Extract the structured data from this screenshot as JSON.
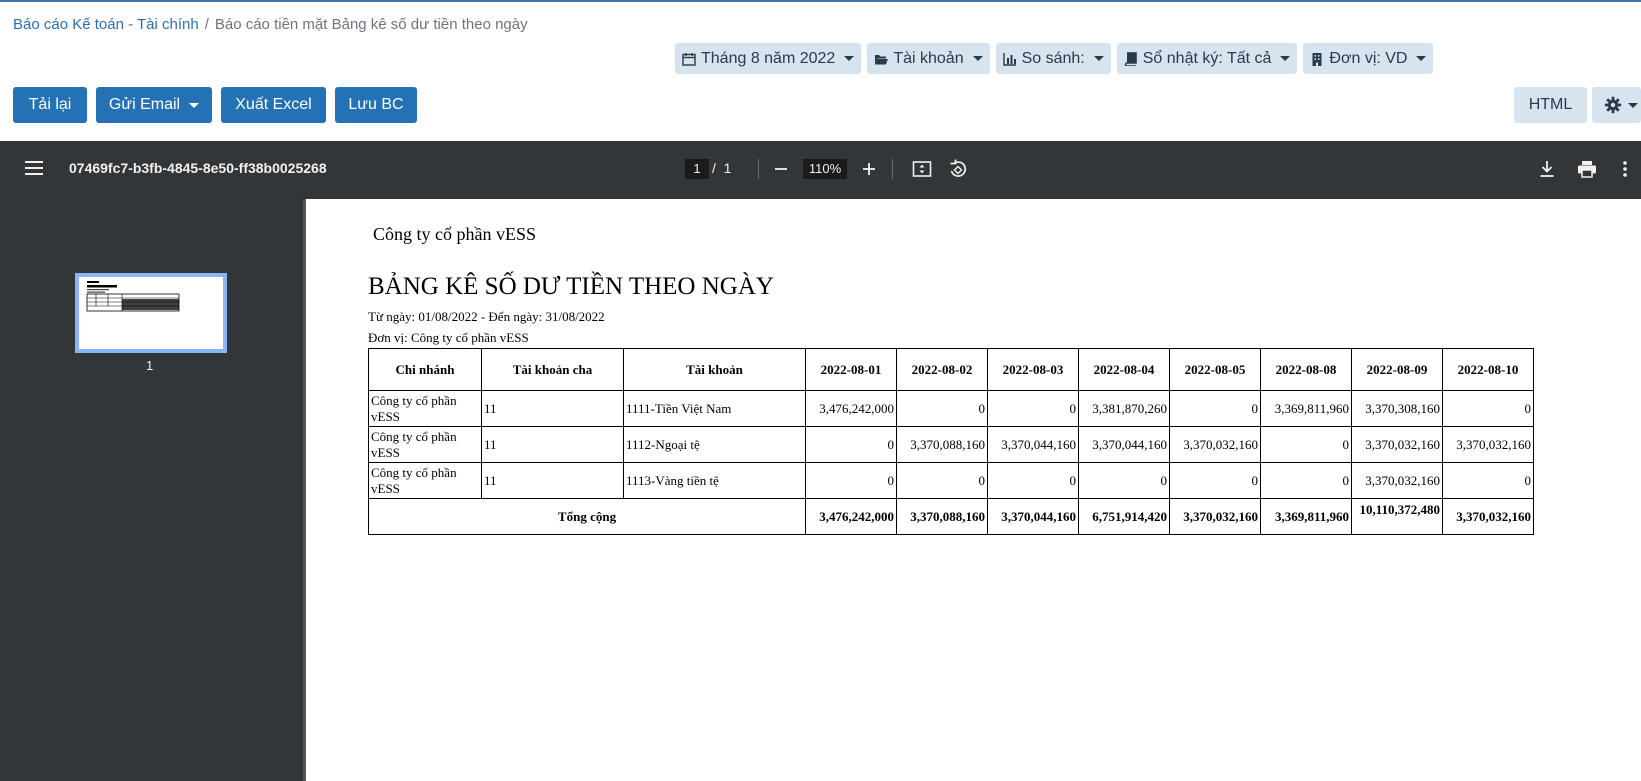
{
  "breadcrumb": {
    "parent": "Báo cáo Kế toán - Tài chính",
    "separator": "/",
    "current": "Báo cáo tiền mặt Bảng kê số dư tiền theo ngày"
  },
  "filters": {
    "period": "Tháng 8 năm 2022",
    "account": "Tài khoản",
    "compare": "So sánh:",
    "journal": "Sổ nhật ký: Tất cả",
    "unit": "Đơn vị: VD"
  },
  "toolbar": {
    "reload": "Tải lại",
    "send_email": "Gửi Email",
    "export_excel": "Xuất Excel",
    "save_report": "Lưu BC",
    "html": "HTML"
  },
  "viewer": {
    "file_name": "07469fc7-b3fb-4845-8e50-ff38b0025268",
    "current_page": "1",
    "page_sep": "/",
    "total_pages": "1",
    "zoom": "110%",
    "thumbnail_label": "1"
  },
  "report": {
    "company": "Công ty cổ phần vESS",
    "title": "BẢNG KÊ SỐ DƯ TIỀN THEO NGÀY",
    "date_range": "Từ ngày: 01/08/2022 - Đến ngày: 31/08/2022",
    "unit": "Đơn vị: Công ty cổ phần vESS",
    "columns": [
      "Chi nhánh",
      "Tài khoản cha",
      "Tài khoản",
      "2022-08-01",
      "2022-08-02",
      "2022-08-03",
      "2022-08-04",
      "2022-08-05",
      "2022-08-08",
      "2022-08-09",
      "2022-08-10"
    ],
    "rows": [
      [
        "Công ty cổ phần vESS",
        "11",
        "1111-Tiền Việt Nam",
        "3,476,242,000",
        "0",
        "0",
        "3,381,870,260",
        "0",
        "3,369,811,960",
        "3,370,308,160",
        "0"
      ],
      [
        "Công ty cổ phần vESS",
        "11",
        "1112-Ngoại tệ",
        "0",
        "3,370,088,160",
        "3,370,044,160",
        "3,370,044,160",
        "3,370,032,160",
        "0",
        "3,370,032,160",
        "3,370,032,160"
      ],
      [
        "Công ty cổ phần vESS",
        "11",
        "1113-Vàng tiền tệ",
        "0",
        "0",
        "0",
        "0",
        "0",
        "0",
        "3,370,032,160",
        "0"
      ]
    ],
    "total_label": "Tổng cộng",
    "totals": [
      "3,476,242,000",
      "3,370,088,160",
      "3,370,044,160",
      "6,751,914,420",
      "3,370,032,160",
      "3,369,811,960",
      "10,110,372,480",
      "3,370,032,160"
    ]
  }
}
